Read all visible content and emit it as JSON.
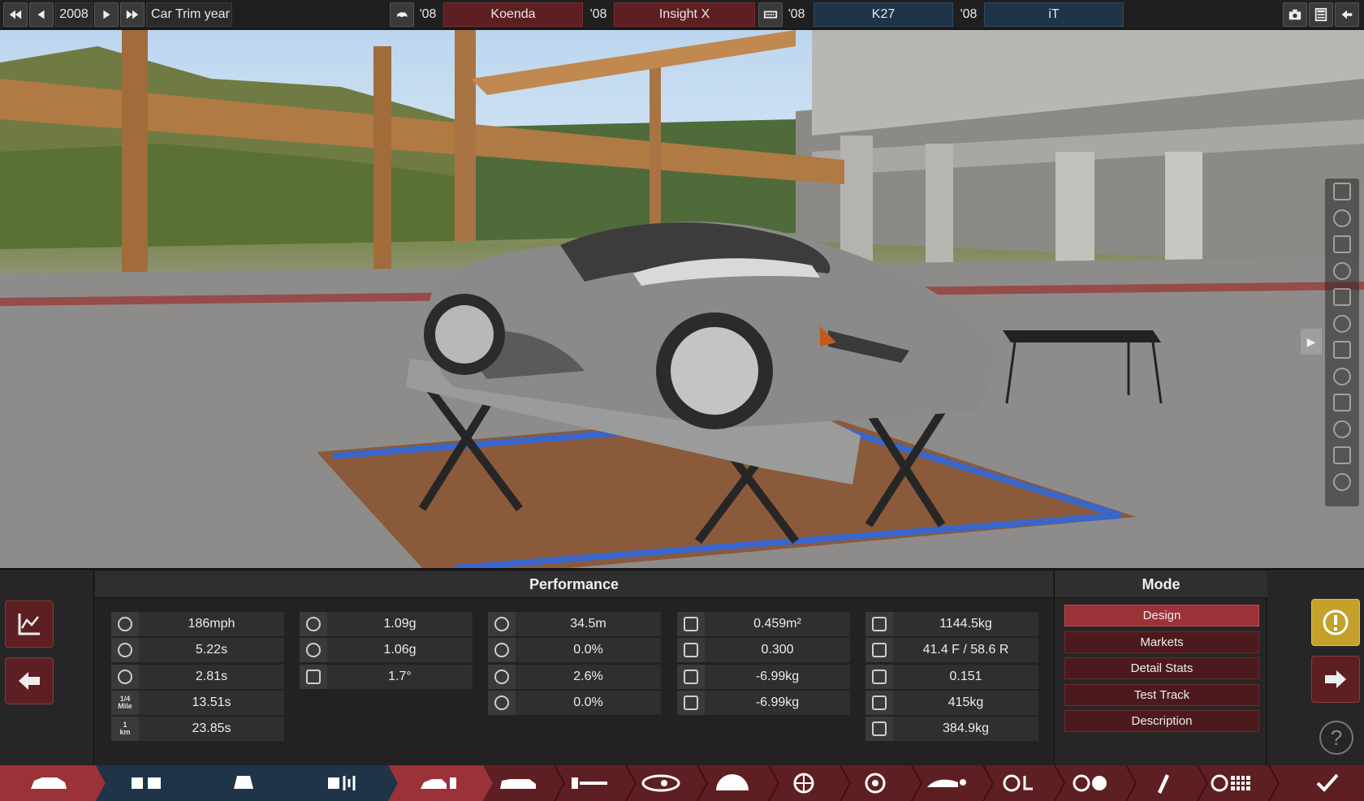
{
  "topbar": {
    "rewind_icon": "fast-rewind-icon",
    "prev_icon": "previous-icon",
    "year": "2008",
    "next_icon": "next-icon",
    "forward_icon": "fast-forward-icon",
    "trim_year_label": "Car Trim year",
    "model_icon": "car-model-icon",
    "model_year": "'08",
    "model_name": "Koenda",
    "trim_year": "'08",
    "trim_name": "Insight X",
    "engine_icon": "engine-icon",
    "engine_year": "'08",
    "engine_name": "K27",
    "variant_year": "'08",
    "variant_name": "iT",
    "screenshot_icon": "camera-icon",
    "calculator_icon": "calculator-icon",
    "back_icon": "back-arrow-icon"
  },
  "side_tools": [
    "walk-icon",
    "wheel-icon",
    "paint-icon",
    "chassis-icon",
    "grille-icon",
    "body-icon",
    "car-icon",
    "engine-bay-icon",
    "suspension-icon",
    "brake-icon",
    "window-icon",
    "light-icon"
  ],
  "panel": {
    "title": "Performance",
    "columns": [
      [
        {
          "icon": "top-speed-icon",
          "value": "186mph"
        },
        {
          "icon": "acceleration-0-100-icon",
          "value": "5.22s"
        },
        {
          "icon": "acceleration-0-60-icon",
          "value": "2.81s"
        },
        {
          "icon_text_top": "1/4",
          "icon_text_bottom": "Mile",
          "value": "13.51s"
        },
        {
          "icon_text_top": "1",
          "icon_text_bottom": "km",
          "value": "23.85s"
        }
      ],
      [
        {
          "icon": "cornering-grip-icon",
          "value": "1.09g"
        },
        {
          "icon": "cornering-grip-high-icon",
          "value": "1.06g"
        },
        {
          "icon": "body-roll-icon",
          "value": "1.7°"
        }
      ],
      [
        {
          "icon": "braking-distance-icon",
          "value": "34.5m"
        },
        {
          "icon": "brake-fade-icon",
          "value": "0.0%"
        },
        {
          "icon": "brake-fade-hot-icon",
          "value": "2.6%"
        },
        {
          "icon": "brake-bias-icon",
          "value": "0.0%"
        }
      ],
      [
        {
          "icon": "frontal-area-icon",
          "value": "0.459m²"
        },
        {
          "icon": "drag-coefficient-icon",
          "value": "0.300"
        },
        {
          "icon": "front-downforce-icon",
          "value": "-6.99kg"
        },
        {
          "icon": "rear-downforce-icon",
          "value": "-6.99kg"
        }
      ],
      [
        {
          "icon": "weight-icon",
          "value": "1144.5kg"
        },
        {
          "icon": "weight-distribution-icon",
          "value": "41.4 F / 58.6 R"
        },
        {
          "icon": "power-to-weight-icon",
          "value": "0.151"
        },
        {
          "icon": "towing-capacity-icon",
          "value": "415kg"
        },
        {
          "icon": "cargo-capacity-icon",
          "value": "384.9kg"
        }
      ]
    ]
  },
  "mode": {
    "title": "Mode",
    "buttons": [
      "Design",
      "Markets",
      "Detail Stats",
      "Test Track",
      "Description"
    ],
    "active": "Design"
  },
  "left_buttons": {
    "graph_icon": "graph-icon",
    "back_icon": "back-arrow-icon"
  },
  "right_buttons": {
    "warning_icon": "warning-icon",
    "next_icon": "next-arrow-icon",
    "help": "?"
  },
  "tabs": [
    "car-model-tab-icon",
    "engine-family-tab-icon",
    "engine-variant-tab-icon",
    "engine-tuning-tab-icon",
    "car-trim-tab-icon",
    "seats-tab-icon",
    "chassis-tab-icon",
    "lights-tab-icon",
    "gearbox-tab-icon",
    "wheels-tab-icon",
    "brakes-tab-icon",
    "aero-tab-icon",
    "steering-tab-icon",
    "driving-tab-icon",
    "paint-tab-icon",
    "testing-tab-icon",
    "confirm-icon"
  ],
  "colors": {
    "accent_red": "#9a3237",
    "dark_red": "#5e1f23",
    "blue": "#1f3448",
    "warning_yellow": "#c3a12a"
  }
}
